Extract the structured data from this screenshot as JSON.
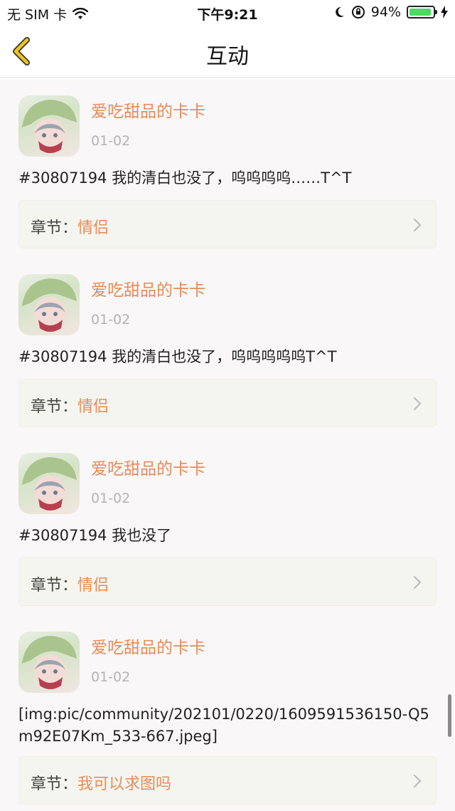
{
  "status_bar": {
    "carrier": "无 SIM 卡",
    "time": "下午9:21",
    "battery_percent": "94%",
    "battery_level": 0.94
  },
  "nav": {
    "title": "互动",
    "back_icon": "chevron-left-icon"
  },
  "posts": [
    {
      "username": "爱吃甜品的卡卡",
      "date": "01-02",
      "content": "#30807194 我的清白也没了，呜呜呜呜……T^T",
      "chapter_label": "章节：",
      "chapter_value": "情侣"
    },
    {
      "username": "爱吃甜品的卡卡",
      "date": "01-02",
      "content": "#30807194 我的清白也没了，呜呜呜呜呜T^T",
      "chapter_label": "章节：",
      "chapter_value": "情侣"
    },
    {
      "username": "爱吃甜品的卡卡",
      "date": "01-02",
      "content": "#30807194 我也没了",
      "chapter_label": "章节：",
      "chapter_value": "情侣"
    },
    {
      "username": "爱吃甜品的卡卡",
      "date": "01-02",
      "content": "[img:pic/community/202101/0220/1609591536150-Q5m92E07Km_533-667.jpeg]",
      "chapter_label": "章节：",
      "chapter_value": "我可以求图吗"
    }
  ],
  "colors": {
    "accent": "#e88b5a",
    "date": "#b4b4b4",
    "back_icon": "#f0c419"
  }
}
